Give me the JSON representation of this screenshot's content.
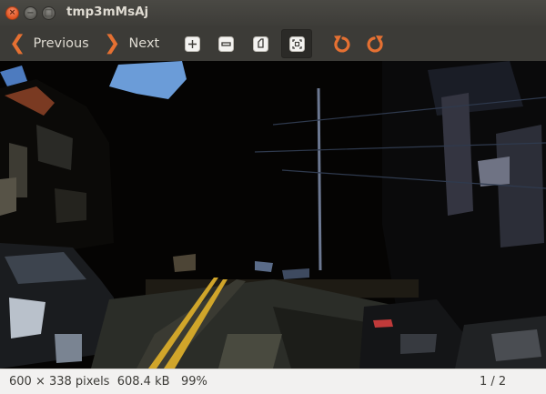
{
  "window": {
    "title": "tmp3mMsAj",
    "close_glyph": "×",
    "minimize_glyph": "−",
    "maximize_glyph": "□"
  },
  "toolbar": {
    "previous_label": "Previous",
    "next_label": "Next",
    "buttons": [
      {
        "name": "zoom-in",
        "icon": "zoom-in-icon"
      },
      {
        "name": "zoom-out",
        "icon": "zoom-out-icon"
      },
      {
        "name": "normal-size",
        "icon": "normal-size-icon"
      },
      {
        "name": "best-fit",
        "icon": "best-fit-icon",
        "active": true
      },
      {
        "name": "rotate-left",
        "icon": "rotate-left-icon"
      },
      {
        "name": "rotate-right",
        "icon": "rotate-right-icon"
      }
    ]
  },
  "image": {
    "description_icon": "posterized street scene"
  },
  "status": {
    "dimensions": "600 × 338 pixels",
    "file_size": "608.4 kB",
    "zoom": "99%",
    "page": "1 / 2"
  },
  "colors": {
    "accent": "#e57032",
    "chrome": "#3c3b37",
    "statusbar": "#f2f1f0"
  }
}
